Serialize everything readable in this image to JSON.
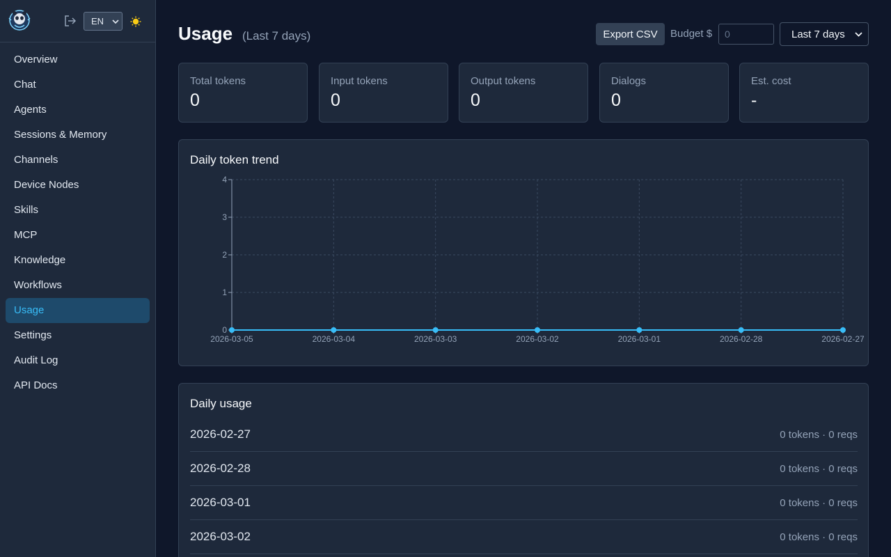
{
  "sidebar": {
    "language": "EN",
    "items": [
      {
        "label": "Overview"
      },
      {
        "label": "Chat"
      },
      {
        "label": "Agents"
      },
      {
        "label": "Sessions & Memory"
      },
      {
        "label": "Channels"
      },
      {
        "label": "Device Nodes"
      },
      {
        "label": "Skills"
      },
      {
        "label": "MCP"
      },
      {
        "label": "Knowledge"
      },
      {
        "label": "Workflows"
      },
      {
        "label": "Usage",
        "active": true
      },
      {
        "label": "Settings"
      },
      {
        "label": "Audit Log"
      },
      {
        "label": "API Docs"
      }
    ],
    "icons": [
      "logo-icon",
      "logout-icon",
      "sun-icon",
      "chevron-down-icon"
    ]
  },
  "header": {
    "title": "Usage",
    "subtitle": "(Last 7 days)",
    "export_label": "Export CSV",
    "budget_label": "Budget $",
    "budget_placeholder": "0",
    "range_value": "Last 7 days"
  },
  "cards": [
    {
      "label": "Total tokens",
      "value": "0"
    },
    {
      "label": "Input tokens",
      "value": "0"
    },
    {
      "label": "Output tokens",
      "value": "0"
    },
    {
      "label": "Dialogs",
      "value": "0"
    },
    {
      "label": "Est. cost",
      "value": "-"
    }
  ],
  "chart_panel": {
    "title": "Daily token trend"
  },
  "chart_data": {
    "type": "line",
    "title": "Daily token trend",
    "x": [
      "2026-03-05",
      "2026-03-04",
      "2026-03-03",
      "2026-03-02",
      "2026-03-01",
      "2026-02-28",
      "2026-02-27"
    ],
    "series": [
      {
        "values": [
          0,
          0,
          0,
          0,
          0,
          0,
          0
        ]
      }
    ],
    "ylim": [
      0,
      4
    ],
    "yticks": [
      0,
      1,
      2,
      3,
      4
    ],
    "grid": true,
    "colors": {
      "line": "#38bdf8",
      "grid": "#3b4a60",
      "axis": "#94a3b8"
    }
  },
  "usage_panel": {
    "title": "Daily usage",
    "rows": [
      {
        "date": "2026-02-27",
        "meta": "0 tokens · 0 reqs"
      },
      {
        "date": "2026-02-28",
        "meta": "0 tokens · 0 reqs"
      },
      {
        "date": "2026-03-01",
        "meta": "0 tokens · 0 reqs"
      },
      {
        "date": "2026-03-02",
        "meta": "0 tokens · 0 reqs"
      }
    ]
  },
  "colors": {
    "background": "#0f172a",
    "panel": "#1e293b",
    "border": "#334155",
    "accent": "#38bdf8",
    "active_nav_bg": "#1e4a6b"
  }
}
